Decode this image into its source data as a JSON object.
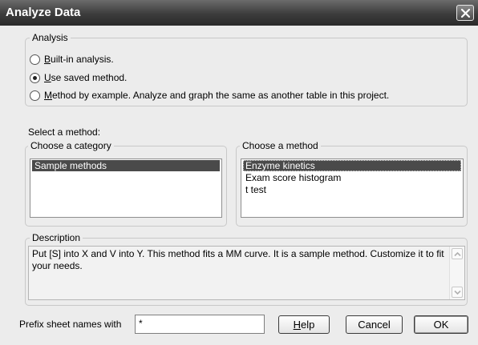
{
  "window": {
    "title": "Analyze Data"
  },
  "analysis": {
    "legend": "Analysis",
    "options": [
      {
        "label_u": "B",
        "label_rest": "uilt-in analysis.",
        "checked": false
      },
      {
        "label_u": "U",
        "label_rest": "se saved method.",
        "checked": true
      },
      {
        "label_u": "M",
        "label_rest": "ethod by example. Analyze and graph the same as another table in this project.",
        "checked": false
      }
    ]
  },
  "select_method_label": "Select a method:",
  "category": {
    "legend": "Choose a category",
    "items": [
      "Sample methods"
    ],
    "selected_index": 0
  },
  "method": {
    "legend": "Choose a method",
    "items": [
      "Enzyme kinetics",
      "Exam score histogram",
      "t test"
    ],
    "selected_index": 0
  },
  "description": {
    "legend": "Description",
    "text": "Put [S] into X and V into Y. This method fits a MM curve. It is a sample method. Customize it to fit your needs."
  },
  "prefix": {
    "label": "Prefix sheet names with",
    "value": "*"
  },
  "buttons": {
    "help_u": "H",
    "help_rest": "elp",
    "cancel": "Cancel",
    "ok": "OK"
  },
  "icons": {
    "close": "close-icon",
    "scroll_up": "chevron-up-icon",
    "scroll_down": "chevron-down-icon"
  }
}
